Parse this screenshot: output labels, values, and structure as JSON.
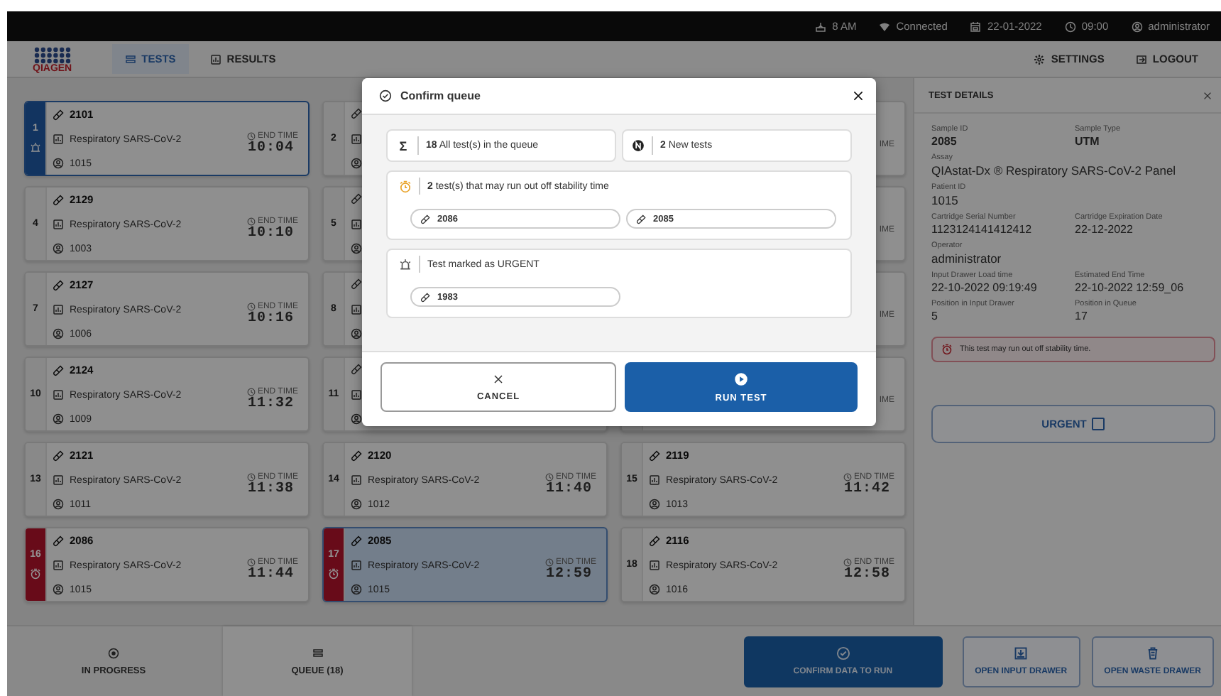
{
  "status_bar": {
    "items": [
      {
        "kind": "drawer",
        "text": "8 AM"
      },
      {
        "kind": "wifi",
        "text": "Connected"
      },
      {
        "kind": "calendar",
        "text": "22-01-2022"
      },
      {
        "kind": "clock",
        "text": "09:00"
      },
      {
        "kind": "user",
        "text": "administrator"
      }
    ]
  },
  "nav": {
    "logo": "QIAGEN",
    "tabs": [
      {
        "kind": "tests",
        "label": "TESTS",
        "selected": true
      },
      {
        "kind": "results",
        "label": "RESULTS",
        "selected": false
      }
    ],
    "actions": [
      {
        "kind": "settings",
        "label": "SETTINGS"
      },
      {
        "kind": "logout",
        "label": "LOGOUT"
      }
    ]
  },
  "queue": {
    "cards": [
      {
        "kind": "full",
        "number": "1",
        "sample": "2101",
        "assay": "Respiratory SARS-CoV-2",
        "patient": "1015",
        "end_label": "END TIME",
        "end_time": "10:04",
        "urgent": true,
        "stability": false,
        "selected": false
      },
      {
        "kind": "covered",
        "number": "2"
      },
      {
        "kind": "covered",
        "end_label": "IME"
      },
      {
        "kind": "full",
        "number": "4",
        "sample": "2129",
        "assay": "Respiratory SARS-CoV-2",
        "patient": "1003",
        "end_label": "END TIME",
        "end_time": "10:10",
        "urgent": false,
        "stability": false,
        "selected": false
      },
      {
        "kind": "covered",
        "number": "5"
      },
      {
        "kind": "covered",
        "end_label": "IME"
      },
      {
        "kind": "full",
        "number": "7",
        "sample": "2127",
        "assay": "Respiratory SARS-CoV-2",
        "patient": "1006",
        "end_label": "END TIME",
        "end_time": "10:16",
        "urgent": false,
        "stability": false,
        "selected": false
      },
      {
        "kind": "covered",
        "number": "8"
      },
      {
        "kind": "covered",
        "end_label": "IME"
      },
      {
        "kind": "full",
        "number": "10",
        "sample": "2124",
        "assay": "Respiratory SARS-CoV-2",
        "patient": "1009",
        "end_label": "END TIME",
        "end_time": "11:32",
        "urgent": false,
        "stability": false,
        "selected": false
      },
      {
        "kind": "covered",
        "number": "11"
      },
      {
        "kind": "covered",
        "end_label": "IME"
      },
      {
        "kind": "full",
        "number": "13",
        "sample": "2121",
        "assay": "Respiratory SARS-CoV-2",
        "patient": "1011",
        "end_label": "END TIME",
        "end_time": "11:38",
        "urgent": false,
        "stability": false,
        "selected": false
      },
      {
        "kind": "full",
        "number": "14",
        "sample": "2120",
        "assay": "Respiratory SARS-CoV-2",
        "patient": "1012",
        "end_label": "END TIME",
        "end_time": "11:40",
        "urgent": false,
        "stability": false,
        "selected": false
      },
      {
        "kind": "full",
        "number": "15",
        "sample": "2119",
        "assay": "Respiratory SARS-CoV-2",
        "patient": "1013",
        "end_label": "END TIME",
        "end_time": "11:42",
        "urgent": false,
        "stability": false,
        "selected": false
      },
      {
        "kind": "full",
        "number": "16",
        "sample": "2086",
        "assay": "Respiratory SARS-CoV-2",
        "patient": "1015",
        "end_label": "END TIME",
        "end_time": "11:44",
        "urgent": false,
        "stability": true,
        "selected": false
      },
      {
        "kind": "full",
        "number": "17",
        "sample": "2085",
        "assay": "Respiratory SARS-CoV-2",
        "patient": "1015",
        "end_label": "END TIME",
        "end_time": "12:59",
        "urgent": false,
        "stability": true,
        "selected": true
      },
      {
        "kind": "full",
        "number": "18",
        "sample": "2116",
        "assay": "Respiratory SARS-CoV-2",
        "patient": "1016",
        "end_label": "END TIME",
        "end_time": "12:58",
        "urgent": false,
        "stability": false,
        "selected": false
      }
    ]
  },
  "details": {
    "title": "TEST DETAILS",
    "rows": [
      [
        {
          "label": "Sample ID",
          "value": "2085"
        },
        {
          "label": "Sample Type",
          "value": "UTM"
        }
      ],
      [
        {
          "label": "Assay",
          "value": "QIAstat-Dx ® Respiratory SARS-CoV-2 Panel"
        }
      ],
      [
        {
          "label": "Patient ID",
          "value": "1015"
        }
      ],
      [
        {
          "label": "Cartridge Serial Number",
          "value": "1123124141412412"
        },
        {
          "label": "Cartridge Expiration Date",
          "value": "22-12-2022"
        }
      ],
      [
        {
          "label": "Operator",
          "value": "administrator"
        }
      ],
      [
        {
          "label": "Input Drawer Load time",
          "value": "22-10-2022 09:19:49"
        },
        {
          "label": "Estimated End Time",
          "value": "22-10-2022 12:59_06"
        }
      ],
      [
        {
          "label": "Position in Input Drawer",
          "value": "5"
        },
        {
          "label": "Position in Queue",
          "value": "17"
        }
      ]
    ],
    "alert": "This test may run out off stability time.",
    "urgent": {
      "label": "URGENT",
      "checked": false
    }
  },
  "bottom_bar": {
    "tabs": [
      {
        "kind": "progress",
        "label": "IN PROGRESS",
        "selected": false
      },
      {
        "kind": "queue",
        "label": "QUEUE (18)",
        "selected": true
      }
    ],
    "buttons": [
      {
        "kind": "check",
        "label": "CONFIRM DATA TO RUN",
        "primary": true
      },
      {
        "kind": "input",
        "label": "OPEN INPUT DRAWER",
        "primary": false
      },
      {
        "kind": "waste",
        "label": "OPEN WASTE DRAWER",
        "primary": false
      }
    ]
  },
  "dialog": {
    "title": "Confirm queue",
    "summary": [
      {
        "kind": "sum",
        "icon": "Σ",
        "text": "**18** All test(s) in the queue"
      },
      {
        "kind": "new",
        "text": "**2** New tests"
      }
    ],
    "sections": [
      {
        "kind": "stability",
        "text": "**2** test(s) that may run out off stability time",
        "samples": [
          "2086",
          "2085"
        ]
      },
      {
        "kind": "urgent",
        "text": "Test marked as URGENT",
        "samples": [
          "1983"
        ]
      }
    ],
    "buttons": [
      {
        "kind": "cancel",
        "label": "CANCEL"
      },
      {
        "kind": "run",
        "label": "RUN TEST"
      }
    ]
  }
}
